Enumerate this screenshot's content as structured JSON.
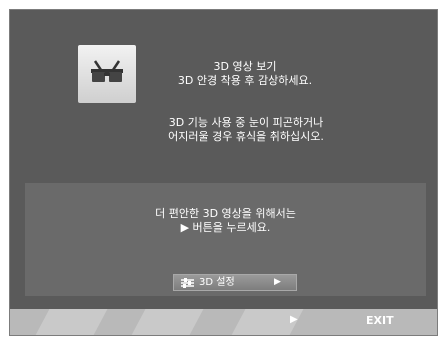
{
  "osd": {
    "icon": "3d-glasses-icon",
    "title_line1": "3D 영상 보기",
    "title_line2": "3D 안경 착용 후 감상하세요.",
    "warning_line1": "3D 기능 사용 중 눈이 피곤하거나",
    "warning_line2": "어지러울 경우 휴식을 취하십시오."
  },
  "panel": {
    "line1": "더 편안한 3D 영상을 위해서는",
    "line2": "▶ 버튼을 누르세요.",
    "button_icon": "settings-sliders-icon",
    "button_label": "3D 설정",
    "button_arrow": "▶"
  },
  "bottom_bar": {
    "arrow": "▶",
    "exit": "EXIT"
  },
  "colors": {
    "background": "#5a5a5a",
    "panel": "#6a6a6a",
    "bottom_bar": "#b9b9b9",
    "text": "#ffffff"
  }
}
